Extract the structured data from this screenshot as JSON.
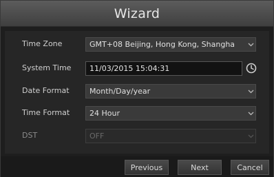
{
  "window": {
    "title": "Wizard"
  },
  "fields": {
    "time_zone": {
      "label": "Time Zone",
      "value": "GMT+08 Beijing, Hong Kong, Shangha"
    },
    "system_time": {
      "label": "System Time",
      "value": "11/03/2015 15:04:31"
    },
    "date_format": {
      "label": "Date Format",
      "value": "Month/Day/year"
    },
    "time_format": {
      "label": "Time Format",
      "value": "24 Hour"
    },
    "dst": {
      "label": "DST",
      "value": "OFF"
    }
  },
  "buttons": {
    "previous": "Previous",
    "next": "Next",
    "cancel": "Cancel"
  },
  "icons": {
    "clock": "clock-icon",
    "dropdown": "chevron-down-icon"
  },
  "colors": {
    "titlebar": "#4d4d4d",
    "panel": "#262626",
    "field": "#3a3a3a"
  }
}
